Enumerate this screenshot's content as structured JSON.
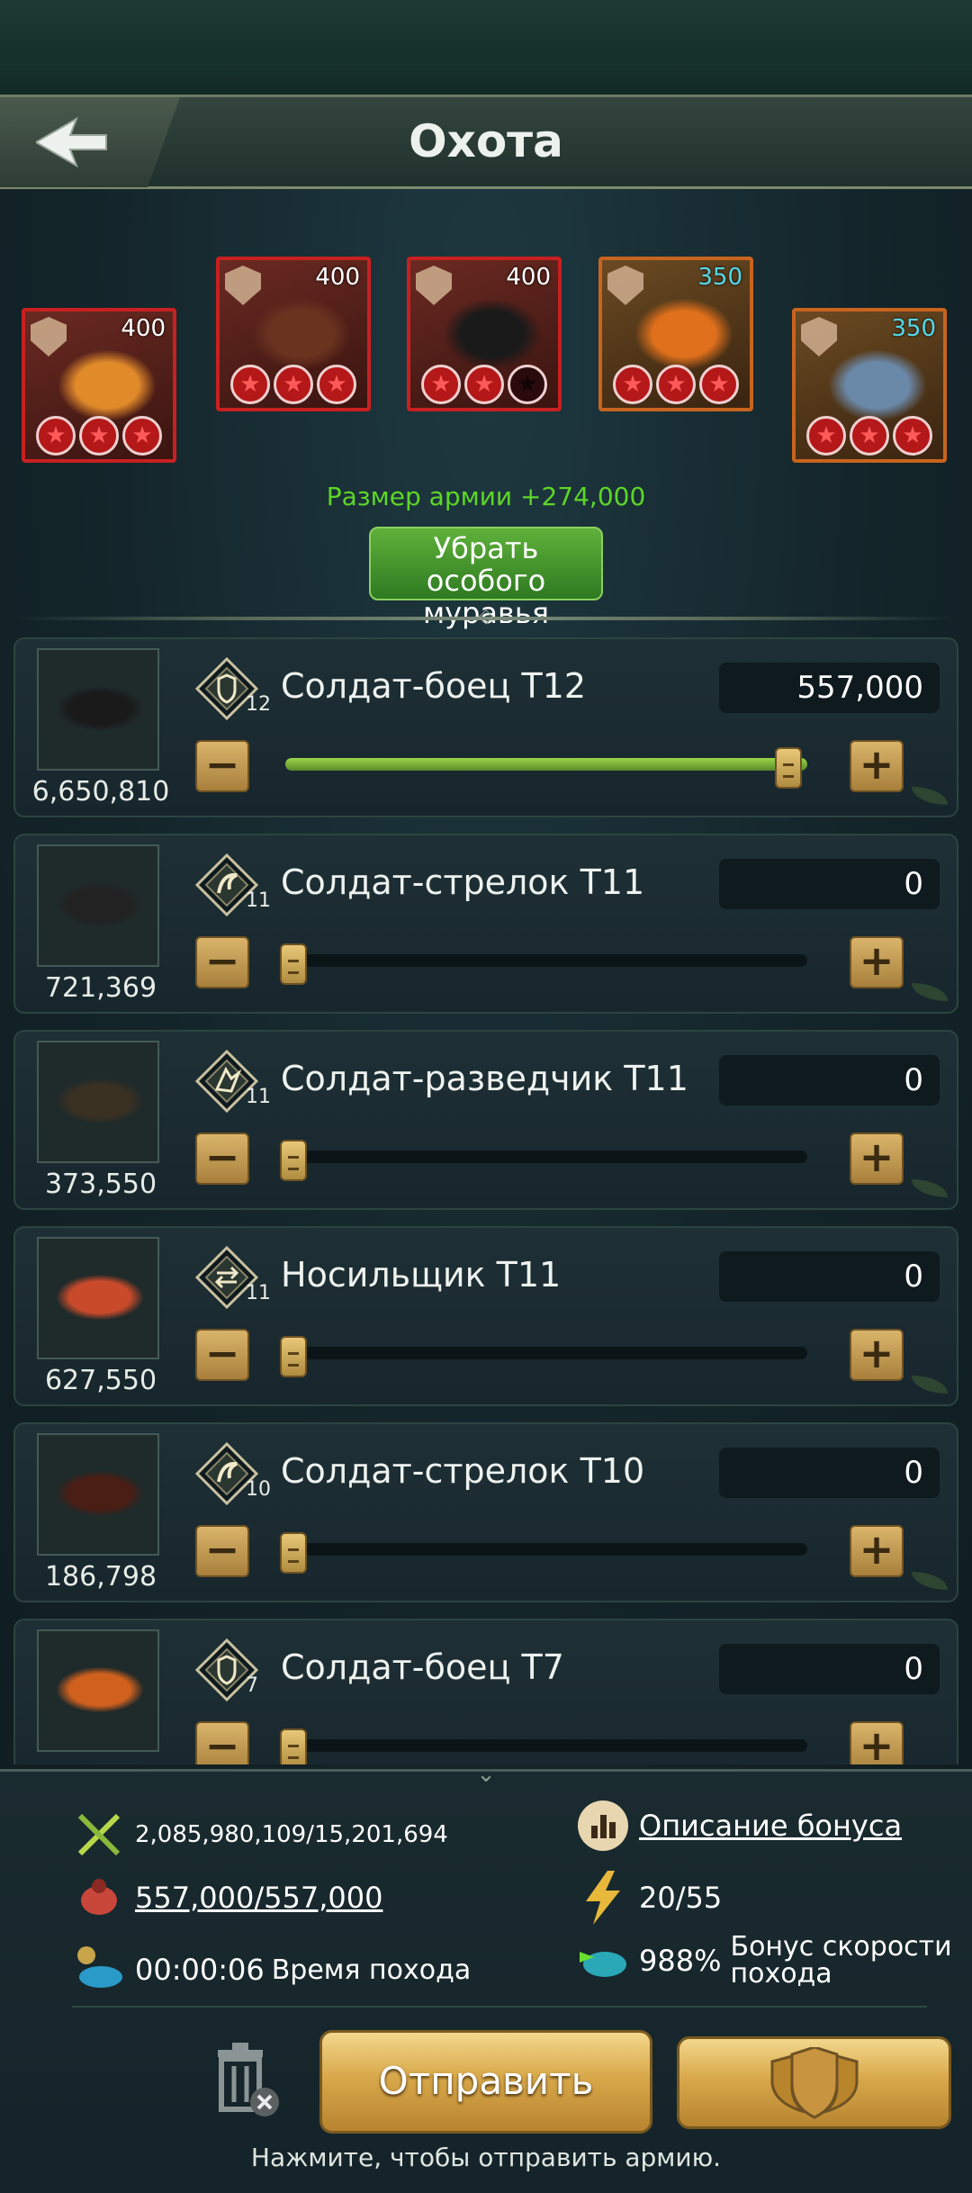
{
  "header": {
    "title": "Охота"
  },
  "special_ants": [
    {
      "level": "400",
      "level_color": "white",
      "frame": "red",
      "stars": [
        true,
        true,
        true
      ],
      "icon": "defense-shield-icon",
      "body_color": "#e08a2a"
    },
    {
      "level": "400",
      "level_color": "white",
      "frame": "red",
      "stars": [
        true,
        true,
        true
      ],
      "icon": "claw-icon",
      "body_color": "#6a3320"
    },
    {
      "level": "400",
      "level_color": "white",
      "frame": "red",
      "stars": [
        true,
        true,
        false
      ],
      "icon": "defense-shield-icon",
      "body_color": "#1a1a1a"
    },
    {
      "level": "350",
      "level_color": "cyan",
      "frame": "orange",
      "stars": [
        true,
        true,
        true
      ],
      "icon": "defense-shield-icon",
      "body_color": "#e0701c"
    },
    {
      "level": "350",
      "level_color": "cyan",
      "frame": "orange",
      "stars": [
        true,
        true,
        true
      ],
      "icon": "defense-shield-icon",
      "body_color": "#6a88a8"
    }
  ],
  "army_size_label": "Размер армии +274,000",
  "remove_special_label": "Убрать особого муравья",
  "troops": [
    {
      "count": "6,650,810",
      "class_icon": "warrior-shield-icon",
      "tier": "12",
      "name": "Солдат-боец Т12",
      "qty": "557,000",
      "slider_fraction": 1.0,
      "ant_color": "#1a1a1a"
    },
    {
      "count": "721,369",
      "class_icon": "shooter-claw-icon",
      "tier": "11",
      "name": "Солдат-стрелок Т11",
      "qty": "0",
      "slider_fraction": 0.0,
      "ant_color": "#222222"
    },
    {
      "count": "373,550",
      "class_icon": "scout-wing-icon",
      "tier": "11",
      "name": "Солдат-разведчик Т11",
      "qty": "0",
      "slider_fraction": 0.0,
      "ant_color": "#3a3022"
    },
    {
      "count": "627,550",
      "class_icon": "carrier-arrows-icon",
      "tier": "11",
      "name": "Носильщик Т11",
      "qty": "0",
      "slider_fraction": 0.0,
      "ant_color": "#c84a2a"
    },
    {
      "count": "186,798",
      "class_icon": "shooter-claw-icon",
      "tier": "10",
      "name": "Солдат-стрелок Т10",
      "qty": "0",
      "slider_fraction": 0.0,
      "ant_color": "#4a1e14"
    },
    {
      "count": "",
      "class_icon": "warrior-shield-icon",
      "tier": "7",
      "name": "Солдат-боец Т7",
      "qty": "0",
      "slider_fraction": 0.0,
      "ant_color": "#d0601e"
    }
  ],
  "footer": {
    "power": "2,085,980,109/15,201,694",
    "bonus_description": "Описание бонуса",
    "load": "557,000/557,000",
    "stamina_current": "20",
    "stamina_max": "/55",
    "march_time": "00:00:06",
    "march_time_label": "Время похода",
    "speed_bonus_value": "988%",
    "speed_bonus_label": "Бонус скорости похода",
    "send_label": "Отправить",
    "hint": "Нажмите, чтобы отправить армию."
  },
  "colors": {
    "accent_green": "#6ade2c",
    "gold": "#d8a84a",
    "background": "#14242a",
    "frame_red": "#c82020",
    "frame_orange": "#c8641e"
  }
}
